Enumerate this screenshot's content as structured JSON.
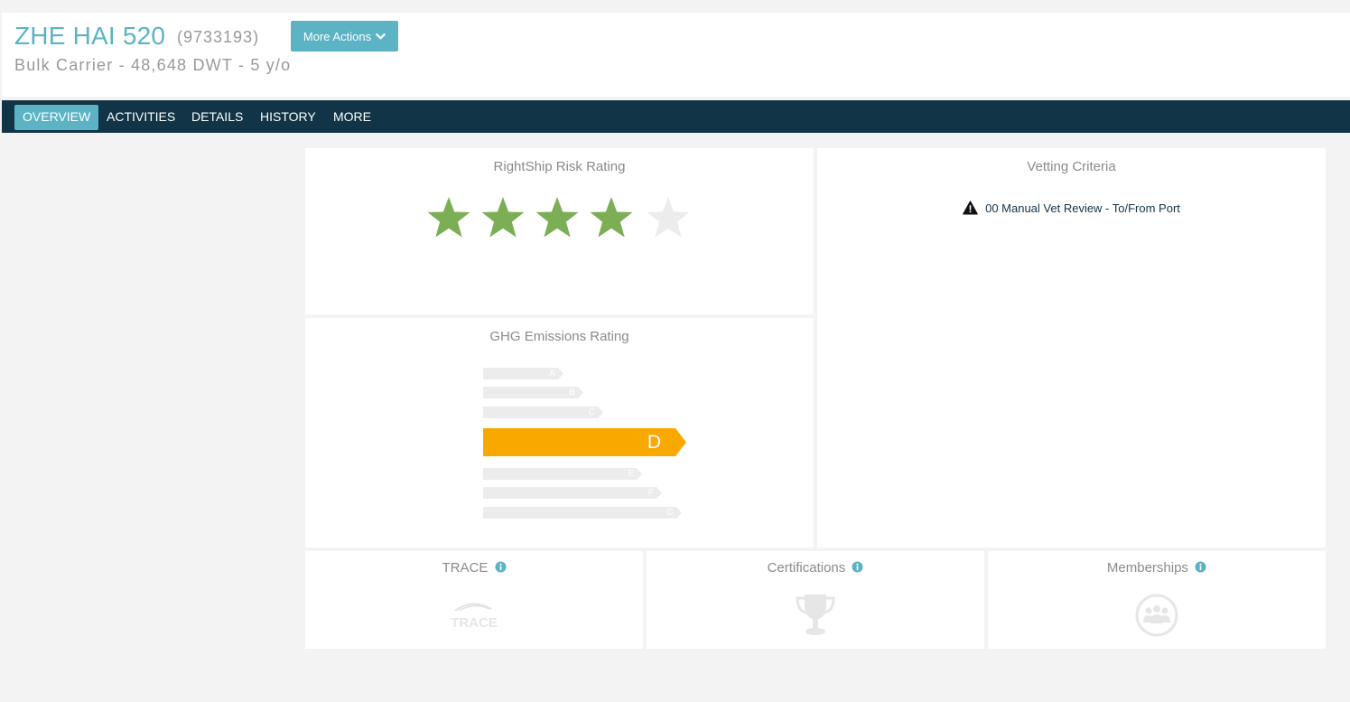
{
  "header": {
    "vessel_name": "ZHE HAI 520",
    "imo": "(9733193)",
    "subtitle": "Bulk Carrier - 48,648 DWT - 5 y/o",
    "more_actions_label": "More Actions"
  },
  "nav": {
    "items": [
      {
        "label": "OVERVIEW",
        "active": true
      },
      {
        "label": "ACTIVITIES",
        "active": false
      },
      {
        "label": "DETAILS",
        "active": false
      },
      {
        "label": "HISTORY",
        "active": false
      },
      {
        "label": "MORE",
        "active": false
      }
    ]
  },
  "risk_rating": {
    "title": "RightShip Risk Rating",
    "stars_filled": 4,
    "stars_total": 5
  },
  "vetting": {
    "title": "Vetting Criteria",
    "item": "00 Manual Vet Review - To/From Port"
  },
  "ghg": {
    "title": "GHG Emissions Rating",
    "grades": [
      "A",
      "B",
      "C",
      "D",
      "E",
      "F",
      "G"
    ],
    "current_grade": "D"
  },
  "trace": {
    "title": "TRACE",
    "icon_text": "TRACE"
  },
  "certifications": {
    "title": "Certifications"
  },
  "memberships": {
    "title": "Memberships"
  },
  "colors": {
    "accent": "#5bb3c4",
    "nav_bg": "#123447",
    "star_filled": "#7cae55",
    "star_empty": "#ececec",
    "ghg_active": "#f9a800",
    "ghg_inactive": "#ececec"
  }
}
